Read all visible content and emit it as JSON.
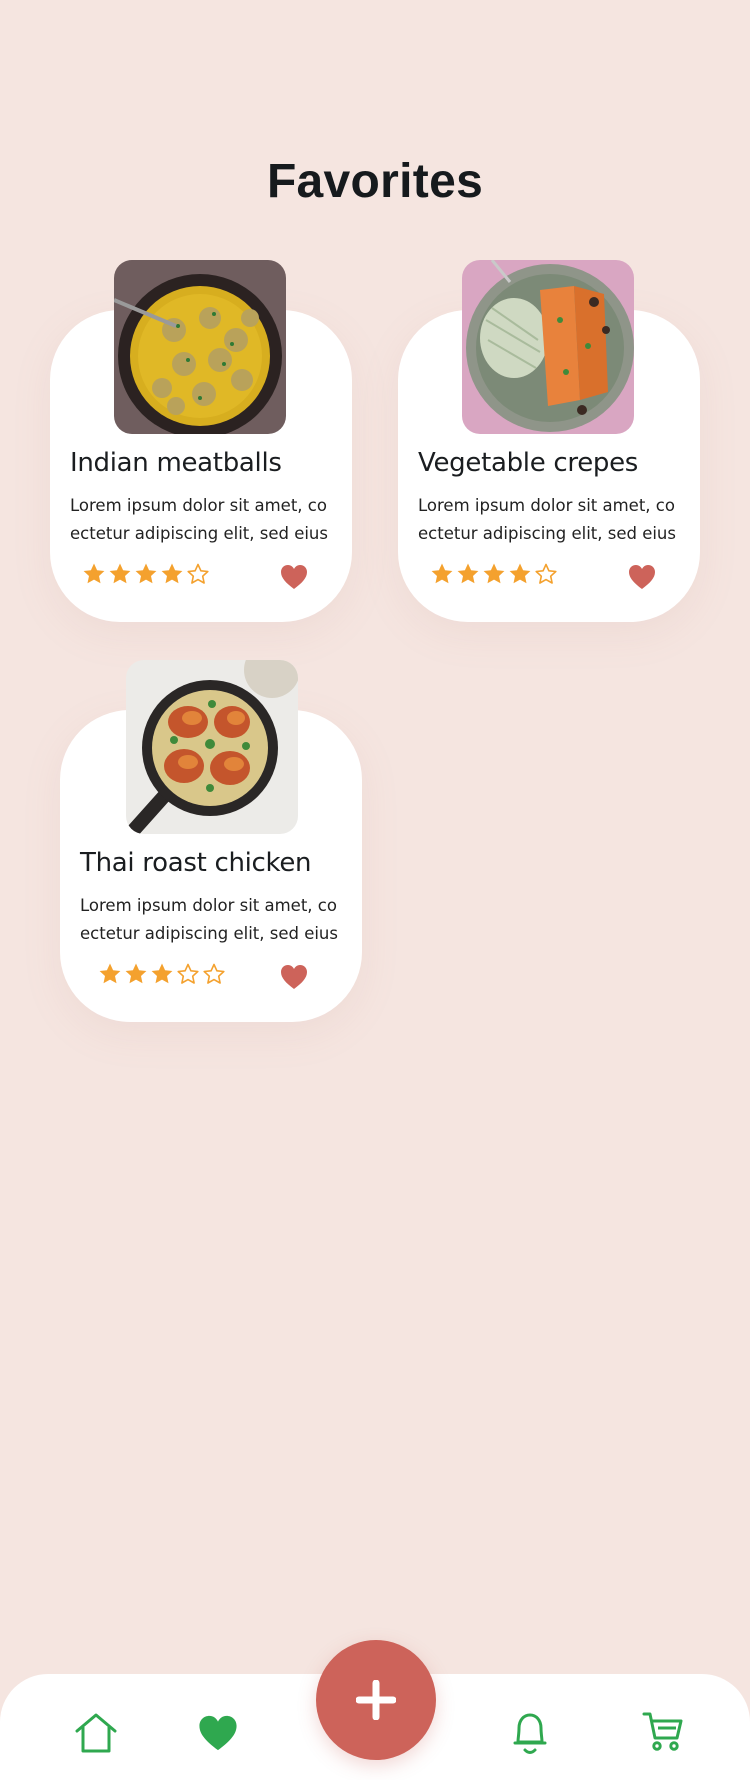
{
  "page": {
    "title": "Favorites"
  },
  "colors": {
    "background": "#f5e5e0",
    "card": "#ffffff",
    "star": "#f4a12e",
    "heart": "#cd635a",
    "nav_accent": "#2fa84f",
    "fab": "#cd635a"
  },
  "favorites": [
    {
      "name": "Indian meatballs",
      "description": "Lorem ipsum dolor sit amet, co ectetur adipiscing elit, sed eius",
      "rating": 4,
      "rating_max": 5,
      "favorited": true,
      "photo_icon": "meatball-curry-photo"
    },
    {
      "name": "Vegetable crepes",
      "description": "Lorem ipsum dolor sit amet, co ectetur adipiscing elit, sed eius",
      "rating": 4,
      "rating_max": 5,
      "favorited": true,
      "photo_icon": "crepes-plate-photo"
    },
    {
      "name": "Thai roast chicken",
      "description": "Lorem ipsum dolor sit amet, co ectetur adipiscing elit, sed eius",
      "rating": 3,
      "rating_max": 5,
      "favorited": true,
      "photo_icon": "roast-chicken-skillet-photo"
    }
  ],
  "bottom_nav": {
    "items": [
      {
        "icon": "home-icon"
      },
      {
        "icon": "heart-icon",
        "active": true
      },
      {
        "icon": "plus-icon"
      },
      {
        "icon": "bell-icon"
      },
      {
        "icon": "cart-icon"
      }
    ]
  }
}
